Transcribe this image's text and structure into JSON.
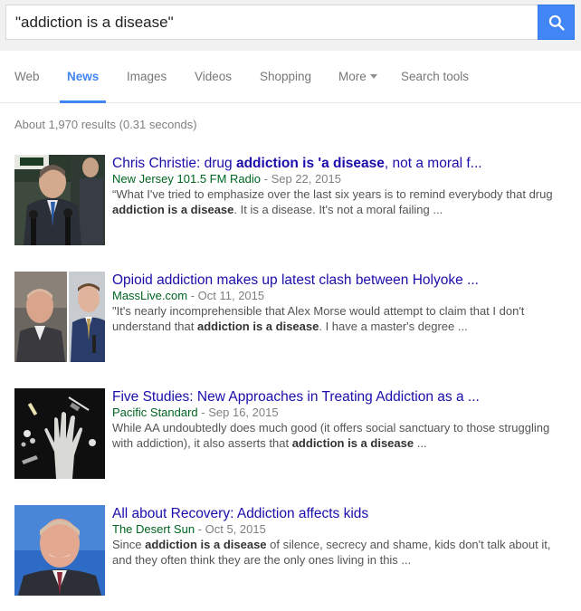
{
  "search": {
    "query": "\"addiction is a disease\"",
    "button_icon": "search-icon"
  },
  "tabs": [
    {
      "label": "Web",
      "active": false
    },
    {
      "label": "News",
      "active": true
    },
    {
      "label": "Images",
      "active": false
    },
    {
      "label": "Videos",
      "active": false
    },
    {
      "label": "Shopping",
      "active": false
    },
    {
      "label": "More",
      "active": false
    },
    {
      "label": "Search tools",
      "active": false
    }
  ],
  "stats": "About 1,970 results (0.31 seconds)",
  "results": [
    {
      "title_parts": [
        "Chris Christie: drug ",
        "addiction is 'a disease",
        ", not a moral f..."
      ],
      "source": "New Jersey 101.5 FM Radio",
      "separator": " - ",
      "date": "Sep 22, 2015",
      "snippet_parts": [
        "“What I've tried to emphasize over the last six years is to remind everybody that drug ",
        "addiction is a disease",
        ". It is a disease. It's not a moral failing ..."
      ]
    },
    {
      "title_parts": [
        "Opioid addiction makes up latest clash between Holyoke ...",
        "",
        ""
      ],
      "source": "MassLive.com",
      "separator": " - ",
      "date": "Oct 11, 2015",
      "snippet_parts": [
        "\"It's nearly incomprehensible that Alex Morse would attempt to claim that I don't understand that ",
        "addiction is a disease",
        ". I have a master's degree ..."
      ]
    },
    {
      "title_parts": [
        "Five Studies: New Approaches in Treating Addiction as a ...",
        "",
        ""
      ],
      "source": "Pacific Standard",
      "separator": " - ",
      "date": "Sep 16, 2015",
      "snippet_parts": [
        "While AA undoubtedly does much good (it offers social sanctuary to those struggling with addiction), it also asserts that ",
        "addiction is a disease",
        " ..."
      ]
    },
    {
      "title_parts": [
        "All about Recovery: Addiction affects kids",
        "",
        ""
      ],
      "source": "The Desert Sun",
      "separator": " - ",
      "date": "Oct 5, 2015",
      "snippet_parts": [
        "Since ",
        "addiction is a disease",
        " of silence, secrecy and shame, kids don't talk about it, and they often think they are the only ones living in this ..."
      ]
    }
  ],
  "colors": {
    "link": "#1a0dab",
    "source": "#006621",
    "accent": "#4285f4"
  }
}
